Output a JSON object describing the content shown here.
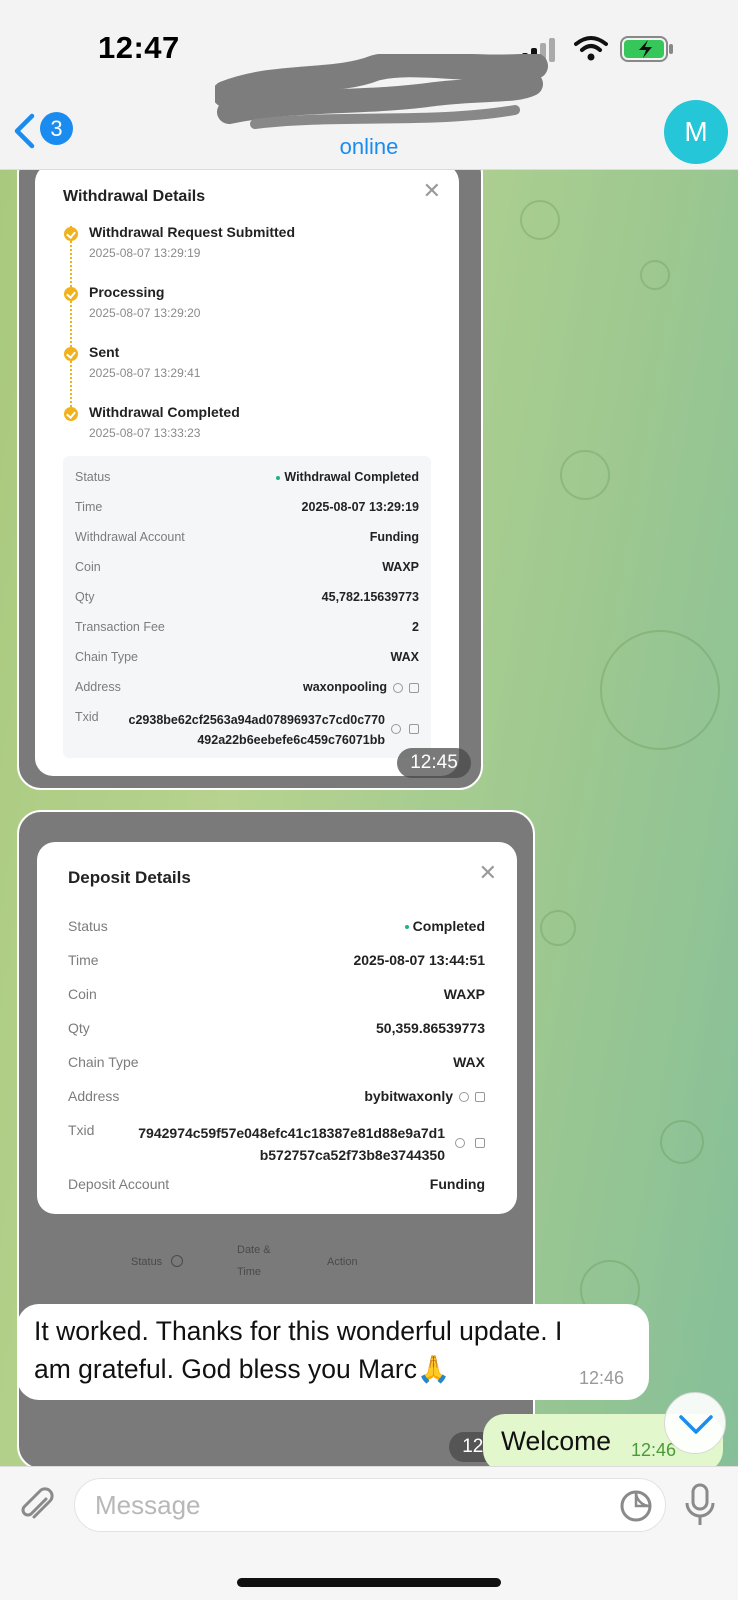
{
  "status_bar": {
    "time": "12:47"
  },
  "header": {
    "unread_count": "3",
    "status": "online",
    "avatar_initial": "M"
  },
  "withdrawal_card": {
    "title": "Withdrawal Details",
    "steps": [
      {
        "title": "Withdrawal Request Submitted",
        "time": "2025-08-07 13:29:19"
      },
      {
        "title": "Processing",
        "time": "2025-08-07 13:29:20"
      },
      {
        "title": "Sent",
        "time": "2025-08-07 13:29:41"
      },
      {
        "title": "Withdrawal Completed",
        "time": "2025-08-07 13:33:23"
      }
    ],
    "rows": [
      {
        "label": "Status",
        "value": "Withdrawal Completed"
      },
      {
        "label": "Time",
        "value": "2025-08-07 13:29:19"
      },
      {
        "label": "Withdrawal Account",
        "value": "Funding"
      },
      {
        "label": "Coin",
        "value": "WAXP"
      },
      {
        "label": "Qty",
        "value": "45,782.15639773"
      },
      {
        "label": "Transaction Fee",
        "value": "2"
      },
      {
        "label": "Chain Type",
        "value": "WAX"
      },
      {
        "label": "Address",
        "value": "waxonpooling"
      },
      {
        "label": "Txid",
        "value_line1": "c2938be62cf2563a94ad07896937c7cd0c770",
        "value_line2": "492a22b6eebefe6c459c76071bb"
      }
    ],
    "timestamp": "12:45"
  },
  "deposit_card": {
    "title": "Deposit Details",
    "rows": [
      {
        "label": "Status",
        "value": "Completed"
      },
      {
        "label": "Time",
        "value": "2025-08-07 13:44:51"
      },
      {
        "label": "Coin",
        "value": "WAXP"
      },
      {
        "label": "Qty",
        "value": "50,359.86539773"
      },
      {
        "label": "Chain Type",
        "value": "WAX"
      },
      {
        "label": "Address",
        "value": "bybitwaxonly"
      },
      {
        "label": "Txid",
        "value_line1": "7942974c59f57e048efc41c18387e81d88e9a7d1",
        "value_line2": "b572757ca52f73b8e3744350"
      },
      {
        "label": "Deposit Account",
        "value": "Funding"
      }
    ],
    "under_columns": [
      "Status",
      "Date &",
      "Time",
      "Action"
    ],
    "timestamp": "12:45"
  },
  "messages": [
    {
      "direction": "incoming",
      "line1": "It worked. Thanks for this wonderful update. I",
      "line2": "am grateful. God bless you Marc🙏",
      "time": "12:46"
    },
    {
      "direction": "outgoing",
      "text": "Welcome",
      "time": "12:46"
    }
  ],
  "input": {
    "placeholder": "Message"
  },
  "colors": {
    "accent": "#1a8cf0",
    "avatar": "#25c6d8",
    "step": "#f2b21c",
    "outgoing_bubble": "#e2f7cb"
  }
}
